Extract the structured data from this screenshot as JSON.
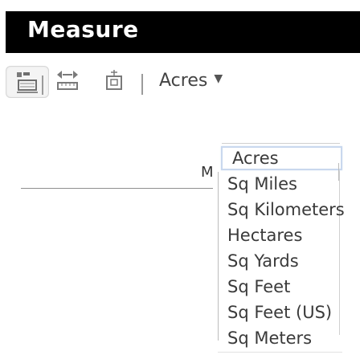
{
  "header": {
    "title": "Measure"
  },
  "toolbar": {
    "tools": [
      {
        "icon": "area-tool-icon"
      },
      {
        "icon": "distance-tool-icon"
      },
      {
        "icon": "location-tool-icon"
      }
    ],
    "unit_select": {
      "value": "Acres",
      "caret": "▼"
    }
  },
  "clipped_label": "M",
  "dropdown": {
    "options": [
      "Acres",
      "Sq Miles",
      "Sq Kilometers",
      "Hectares",
      "Sq Yards",
      "Sq Feet",
      "Sq Feet (US)",
      "Sq Meters"
    ],
    "selected": "Acres"
  }
}
